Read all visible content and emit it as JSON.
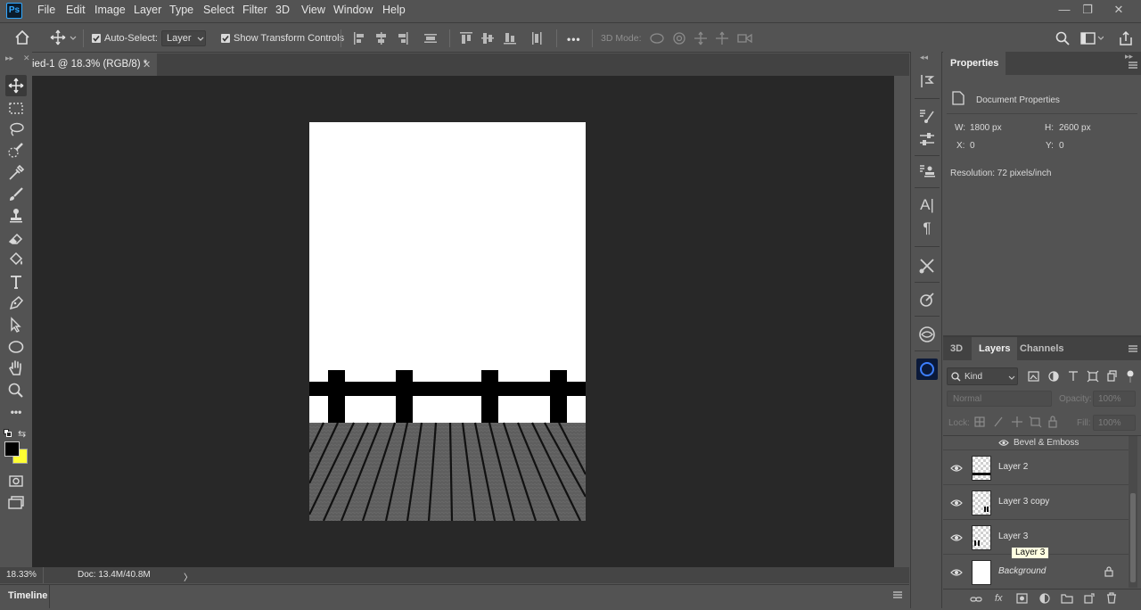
{
  "app": {
    "logo_text": "Ps"
  },
  "menu": [
    "File",
    "Edit",
    "Image",
    "Layer",
    "Type",
    "Select",
    "Filter",
    "3D",
    "View",
    "Window",
    "Help"
  ],
  "window_controls": [
    "—",
    "❐",
    "✕"
  ],
  "options_bar": {
    "auto_select_label": "Auto-Select:",
    "auto_select_checked": true,
    "auto_select_target": "Layer",
    "show_transform_label": "Show Transform Controls",
    "show_transform_checked": true,
    "more_label": "•••",
    "mode_3d_label": "3D Mode:"
  },
  "document_tab": {
    "title": "ied-1 @ 18.3% (RGB/8) *",
    "close": "✕"
  },
  "tools": [
    "move-tool",
    "marquee-tool",
    "lasso-tool",
    "quick-select-tool",
    "eyedropper-tool",
    "brush-tool",
    "clone-stamp-tool",
    "eraser-tool",
    "paint-bucket-tool",
    "type-tool",
    "pen-tool",
    "path-select-tool",
    "ellipse-tool",
    "hand-tool",
    "zoom-tool",
    "more-tools"
  ],
  "colors": {
    "foreground": "#000000",
    "background": "#ffff33",
    "canvas_bg": "#282828",
    "ui_panel": "#535353"
  },
  "status": {
    "zoom": "18.33%",
    "doc": "Doc: 13.4M/40.8M",
    "arrow": "〉"
  },
  "timeline": {
    "label": "Timeline"
  },
  "properties": {
    "tab": "Properties",
    "section": "Document Properties",
    "w_label": "W:",
    "w_value": "1800 px",
    "h_label": "H:",
    "h_value": "2600 px",
    "x_label": "X:",
    "x_value": "0",
    "y_label": "Y:",
    "y_value": "0",
    "resolution": "Resolution: 72 pixels/inch"
  },
  "layers_panel": {
    "tabs": [
      "3D",
      "Layers",
      "Channels"
    ],
    "active_tab": "Layers",
    "filter_label": "Kind",
    "blend_mode": "Normal",
    "opacity_label": "Opacity:",
    "opacity_value": "100%",
    "lock_label": "Lock:",
    "fill_label": "Fill:",
    "fill_value": "100%",
    "effect_label": "Bevel & Emboss",
    "layers": [
      {
        "name": "Layer 2",
        "italic": false
      },
      {
        "name": "Layer 3 copy",
        "italic": false
      },
      {
        "name": "Layer 3",
        "italic": false
      },
      {
        "name": "Background",
        "italic": true
      }
    ],
    "tooltip": "Layer 3"
  }
}
